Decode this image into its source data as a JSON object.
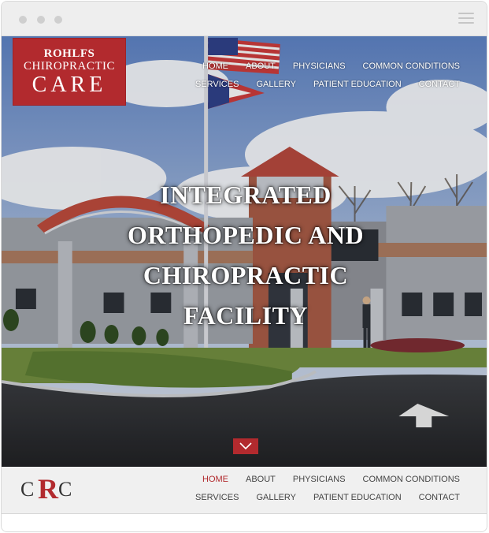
{
  "brand": {
    "logo_line1": "ROHLFS",
    "logo_line2": "CHIROPRACTIC",
    "logo_line3": "CARE",
    "mark_c1": "C",
    "mark_r": "R",
    "mark_c2": "C",
    "accent_color": "#b22a2e"
  },
  "nav": {
    "row1": [
      "HOME",
      "ABOUT",
      "PHYSICIANS",
      "COMMON CONDITIONS"
    ],
    "row2": [
      "SERVICES",
      "GALLERY",
      "PATIENT EDUCATION",
      "CONTACT"
    ],
    "active": "HOME"
  },
  "hero": {
    "headline_lines": [
      "INTEGRATED",
      "ORTHOPEDIC AND",
      "CHIROPRACTIC",
      "FACILITY"
    ],
    "scroll_icon": "chevron-down-icon"
  },
  "window": {
    "menu_icon": "hamburger-menu-icon"
  }
}
